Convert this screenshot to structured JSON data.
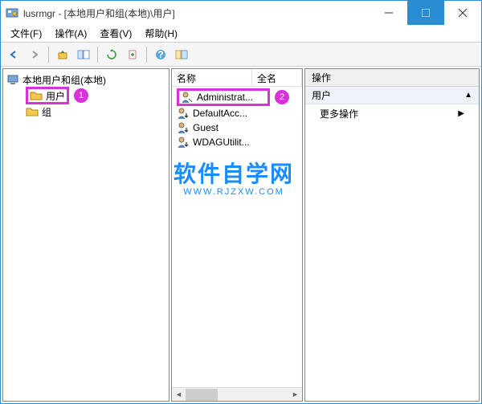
{
  "title": "lusrmgr - [本地用户和组(本地)\\用户]",
  "menu": {
    "file": "文件(F)",
    "action": "操作(A)",
    "view": "查看(V)",
    "help": "帮助(H)"
  },
  "tree": {
    "root": "本地用户和组(本地)",
    "users": "用户",
    "groups": "组"
  },
  "columns": {
    "name": "名称",
    "fullname": "全名"
  },
  "users_list": [
    {
      "label": "Administrat..."
    },
    {
      "label": "DefaultAcc..."
    },
    {
      "label": "Guest"
    },
    {
      "label": "WDAGUtilit..."
    }
  ],
  "actions": {
    "header": "操作",
    "section": "用户",
    "more": "更多操作"
  },
  "badges": {
    "b1": "1",
    "b2": "2"
  },
  "watermark": {
    "main": "软件自学网",
    "sub": "WWW.RJZXW.COM"
  }
}
